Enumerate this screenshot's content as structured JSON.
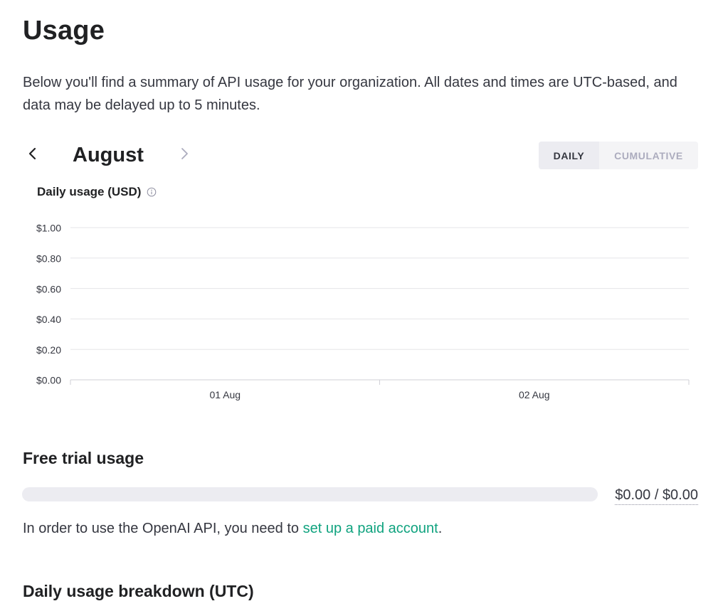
{
  "page": {
    "title": "Usage",
    "description": "Below you'll find a summary of API usage for your organization. All dates and times are UTC-based, and data may be delayed up to 5 minutes."
  },
  "month_nav": {
    "month": "August",
    "prev_icon": "chevron-left-icon",
    "next_icon": "chevron-right-icon",
    "next_enabled": false
  },
  "view_toggle": {
    "daily": "DAILY",
    "cumulative": "CUMULATIVE",
    "selected": "DAILY"
  },
  "usage_chart": {
    "title": "Daily usage (USD)",
    "info_icon": "info-icon"
  },
  "chart_data": {
    "type": "bar",
    "title": "Daily usage (USD)",
    "categories": [
      "01 Aug",
      "02 Aug"
    ],
    "values": [
      0,
      0
    ],
    "xlabel": "",
    "ylabel": "",
    "ylim": [
      0,
      1
    ],
    "y_ticks": [
      1.0,
      0.8,
      0.6,
      0.4,
      0.2,
      0.0
    ],
    "y_tick_labels": [
      "$1.00",
      "$0.80",
      "$0.60",
      "$0.40",
      "$0.20",
      "$0.00"
    ],
    "grid": true
  },
  "free_trial": {
    "heading": "Free trial usage",
    "amount": "$0.00 / $0.00",
    "progress": 0,
    "notice_prefix": "In order to use the OpenAI API, you need to ",
    "notice_link": "set up a paid account",
    "notice_suffix": "."
  },
  "breakdown": {
    "heading": "Daily usage breakdown (UTC)"
  },
  "colors": {
    "accent": "#10a37f",
    "text": "#202123",
    "muted": "#acacbe",
    "track": "#ececf1"
  }
}
